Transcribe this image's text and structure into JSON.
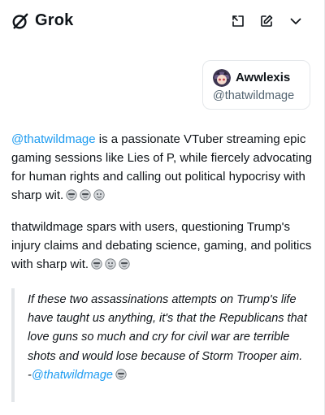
{
  "header": {
    "app_name": "Grok",
    "actions": [
      "expand-icon",
      "new-chat-icon",
      "chevron-down-icon"
    ]
  },
  "profile_card": {
    "name": "Awwlexis",
    "handle": "@thatwildmage"
  },
  "message": {
    "para1_mention": "@thatwildmage",
    "para1_text": " is a passionate VTuber streaming epic gaming sessions like Lies of P, while fiercely advocating for human rights and calling out political hypocrisy with sharp wit.",
    "para2_text": "thatwildmage spars with users, questioning Trump's injury claims and debating science, gaming, and politics with sharp wit.",
    "quote_text": "If these two assassinations attempts on Trump's life have taught us anything, it's that the Republicans that love guns so much and cry for civil war are terrible shots and would lose because of Storm Trooper aim.",
    "quote_prefix": "-",
    "quote_mention": "@thatwildmage"
  },
  "colors": {
    "accent": "#1d9bf0",
    "text": "#0f1419",
    "muted": "#536471",
    "border": "#e5e8eb"
  }
}
